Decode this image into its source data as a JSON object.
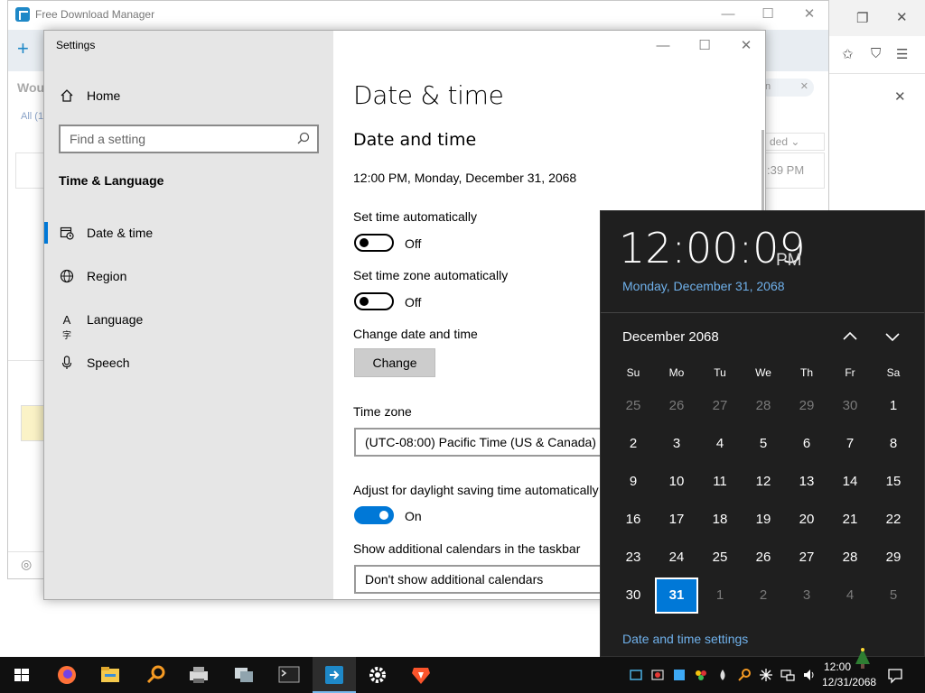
{
  "fdm": {
    "title": "Free Download Manager",
    "search_fragment": "Woul",
    "tab_fragment": "All (1",
    "search_pill": "n",
    "col_header": "ded",
    "col_time": ":39 PM"
  },
  "settings": {
    "window_title": "Settings",
    "home_label": "Home",
    "find_placeholder": "Find a setting",
    "section": "Time & Language",
    "nav": [
      {
        "label": "Date & time",
        "icon": "calendar-clock-icon"
      },
      {
        "label": "Region",
        "icon": "globe-icon"
      },
      {
        "label": "Language",
        "icon": "language-icon"
      },
      {
        "label": "Speech",
        "icon": "microphone-icon"
      }
    ],
    "page_title": "Date & time",
    "subtitle": "Date and time",
    "current_datetime": "12:00 PM, Monday, December 31, 2068",
    "set_time_auto_label": "Set time automatically",
    "set_time_auto_state": "Off",
    "set_tz_auto_label": "Set time zone automatically",
    "set_tz_auto_state": "Off",
    "change_label": "Change date and time",
    "change_button": "Change",
    "timezone_label": "Time zone",
    "timezone_value": "(UTC-08:00) Pacific Time (US & Canada)",
    "dst_label": "Adjust for daylight saving time automatically",
    "dst_state": "On",
    "calendars_label": "Show additional calendars in the taskbar",
    "calendars_value": "Don't show additional calendars"
  },
  "flyout": {
    "time": "12:00:09",
    "ampm": "PM",
    "date": "Monday, December 31, 2068",
    "month": "December 2068",
    "weekdays": [
      "Su",
      "Mo",
      "Tu",
      "We",
      "Th",
      "Fr",
      "Sa"
    ],
    "weeks": [
      [
        {
          "d": "25",
          "m": "prev"
        },
        {
          "d": "26",
          "m": "prev"
        },
        {
          "d": "27",
          "m": "prev"
        },
        {
          "d": "28",
          "m": "prev"
        },
        {
          "d": "29",
          "m": "prev"
        },
        {
          "d": "30",
          "m": "prev"
        },
        {
          "d": "1",
          "m": "cur"
        }
      ],
      [
        {
          "d": "2",
          "m": "cur"
        },
        {
          "d": "3",
          "m": "cur"
        },
        {
          "d": "4",
          "m": "cur"
        },
        {
          "d": "5",
          "m": "cur"
        },
        {
          "d": "6",
          "m": "cur"
        },
        {
          "d": "7",
          "m": "cur"
        },
        {
          "d": "8",
          "m": "cur"
        }
      ],
      [
        {
          "d": "9",
          "m": "cur"
        },
        {
          "d": "10",
          "m": "cur"
        },
        {
          "d": "11",
          "m": "cur"
        },
        {
          "d": "12",
          "m": "cur"
        },
        {
          "d": "13",
          "m": "cur"
        },
        {
          "d": "14",
          "m": "cur"
        },
        {
          "d": "15",
          "m": "cur"
        }
      ],
      [
        {
          "d": "16",
          "m": "cur"
        },
        {
          "d": "17",
          "m": "cur"
        },
        {
          "d": "18",
          "m": "cur"
        },
        {
          "d": "19",
          "m": "cur"
        },
        {
          "d": "20",
          "m": "cur"
        },
        {
          "d": "21",
          "m": "cur"
        },
        {
          "d": "22",
          "m": "cur"
        }
      ],
      [
        {
          "d": "23",
          "m": "cur"
        },
        {
          "d": "24",
          "m": "cur"
        },
        {
          "d": "25",
          "m": "cur"
        },
        {
          "d": "26",
          "m": "cur"
        },
        {
          "d": "27",
          "m": "cur"
        },
        {
          "d": "28",
          "m": "cur"
        },
        {
          "d": "29",
          "m": "cur"
        }
      ],
      [
        {
          "d": "30",
          "m": "cur"
        },
        {
          "d": "31",
          "m": "today"
        },
        {
          "d": "1",
          "m": "next"
        },
        {
          "d": "2",
          "m": "next"
        },
        {
          "d": "3",
          "m": "next"
        },
        {
          "d": "4",
          "m": "next"
        },
        {
          "d": "5",
          "m": "next"
        }
      ]
    ],
    "settings_link": "Date and time settings"
  },
  "taskbar": {
    "apps": [
      "start-icon",
      "firefox-icon",
      "file-explorer-icon",
      "search-tool-icon",
      "printer-icon",
      "network-icon",
      "terminal-icon",
      "download-manager-icon",
      "settings-gear-icon",
      "brave-icon"
    ],
    "clock_time": "12:00",
    "clock_date": "12/31/2068"
  },
  "colors": {
    "accent": "#0078d7",
    "flyout_bg": "#1f1f1f",
    "link": "#6fb0ea",
    "taskbar": "#101010"
  }
}
